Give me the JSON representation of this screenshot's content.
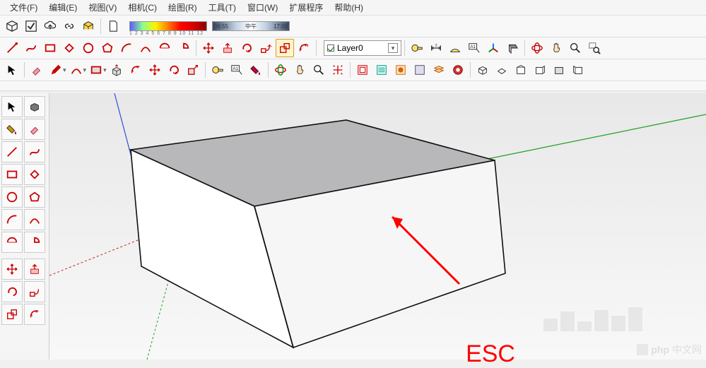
{
  "menu": {
    "file": "文件(F)",
    "edit": "编辑(E)",
    "view": "视图(V)",
    "camera": "相机(C)",
    "draw": "绘图(R)",
    "tools": "工具(T)",
    "window": "窗口(W)",
    "extensions": "扩展程序",
    "help": "帮助(H)"
  },
  "toolbar1": {
    "color_scale_labels": "1 2 3 4 5 6 7 8 9 10 11 12",
    "time_left": "06:55",
    "time_mid": "中午",
    "time_right": "17:00"
  },
  "layer": {
    "current": "Layer0"
  },
  "annotation": {
    "text": "ESC"
  },
  "watermark": {
    "text": "中文网",
    "prefix": "php"
  },
  "icons": {
    "model": "model-icon",
    "check": "check-icon",
    "cloud": "cloud-upload-icon",
    "link": "link-icon",
    "warehouse": "warehouse-icon",
    "eraser_page": "page-icon",
    "select": "select-arrow-icon",
    "eraser": "eraser-icon",
    "line": "line-icon",
    "arc": "arc-icon",
    "rect": "rectangle-icon",
    "circle": "circle-icon",
    "polygon": "polygon-icon",
    "freehand": "freehand-icon",
    "move": "move-icon",
    "pushpull": "pushpull-icon",
    "rotate": "rotate-icon",
    "followme": "followme-icon",
    "scale": "scale-icon",
    "offset": "offset-icon",
    "tape": "tape-measure-icon",
    "protractor": "protractor-icon",
    "dim": "dimension-icon",
    "text": "text-icon",
    "axes": "axes-icon",
    "section": "section-plane-icon",
    "orbit": "orbit-icon",
    "pan": "pan-icon",
    "zoom": "zoom-icon",
    "zoomwin": "zoom-window-icon",
    "zoomext": "zoom-extents-icon",
    "iso": "iso-view-icon",
    "top": "top-view-icon",
    "front": "front-view-icon",
    "right": "right-view-icon",
    "back": "back-view-icon",
    "left": "left-view-icon",
    "paint": "paint-bucket-icon"
  }
}
